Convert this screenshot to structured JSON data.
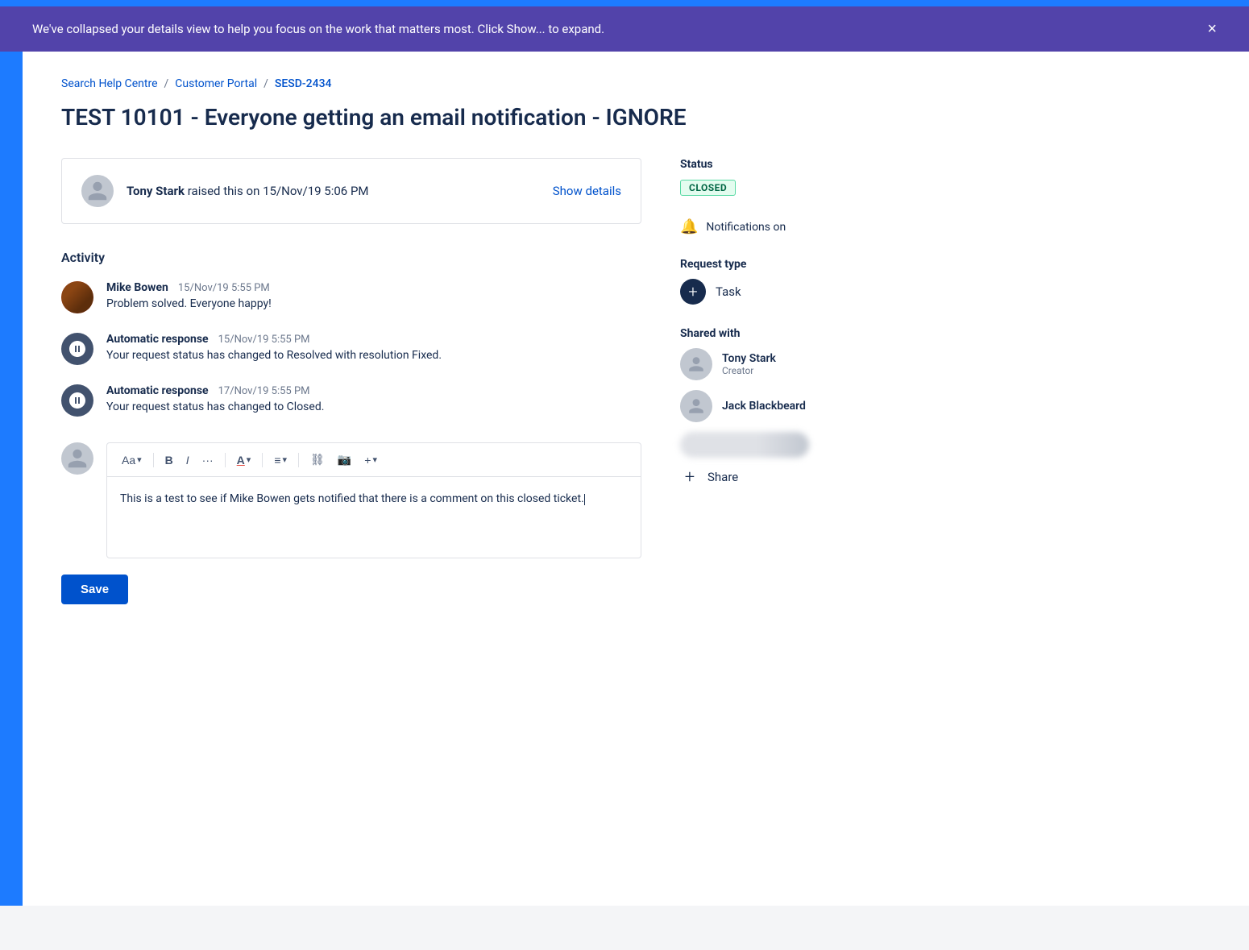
{
  "banner": {
    "message": "We've collapsed your details view to help you focus on the work that matters most. Click Show... to expand.",
    "close_label": "×"
  },
  "breadcrumb": {
    "items": [
      {
        "label": "Search Help Centre",
        "href": "#"
      },
      {
        "label": "Customer Portal",
        "href": "#"
      },
      {
        "label": "SESD-2434",
        "href": "#",
        "highlight": true
      }
    ],
    "separators": [
      "/",
      "/"
    ]
  },
  "page": {
    "title": "TEST 10101 - Everyone getting an email notification - IGNORE"
  },
  "raised": {
    "user": "Tony Stark",
    "text": "raised this on 15/Nov/19 5:06 PM",
    "show_details": "Show details"
  },
  "activity": {
    "label": "Activity",
    "items": [
      {
        "id": 1,
        "type": "user",
        "name": "Mike Bowen",
        "time": "15/Nov/19 5:55 PM",
        "message": "Problem solved. Everyone happy!"
      },
      {
        "id": 2,
        "type": "auto",
        "name": "Automatic response",
        "time": "15/Nov/19 5:55 PM",
        "message": "Your request status has changed to Resolved with resolution Fixed."
      },
      {
        "id": 3,
        "type": "auto",
        "name": "Automatic response",
        "time": "17/Nov/19 5:55 PM",
        "message": "Your request status has changed to Closed."
      }
    ]
  },
  "editor": {
    "toolbar": {
      "text_style": "Aa",
      "bold": "B",
      "italic": "I",
      "more": "···",
      "text_color": "A",
      "list": "≡",
      "link": "🔗",
      "image": "🖼",
      "more2": "+"
    },
    "content": "This is a test to see if Mike Bowen gets notified that there is a comment on this closed ticket."
  },
  "save_button": "Save",
  "sidebar": {
    "status": {
      "label": "Status",
      "value": "CLOSED"
    },
    "notifications": {
      "label": "Notifications on"
    },
    "request_type": {
      "label": "Request type",
      "value": "Task"
    },
    "shared_with": {
      "label": "Shared with",
      "users": [
        {
          "name": "Tony Stark",
          "role": "Creator"
        },
        {
          "name": "Jack Blackbeard",
          "role": ""
        }
      ],
      "share_label": "Share"
    }
  }
}
